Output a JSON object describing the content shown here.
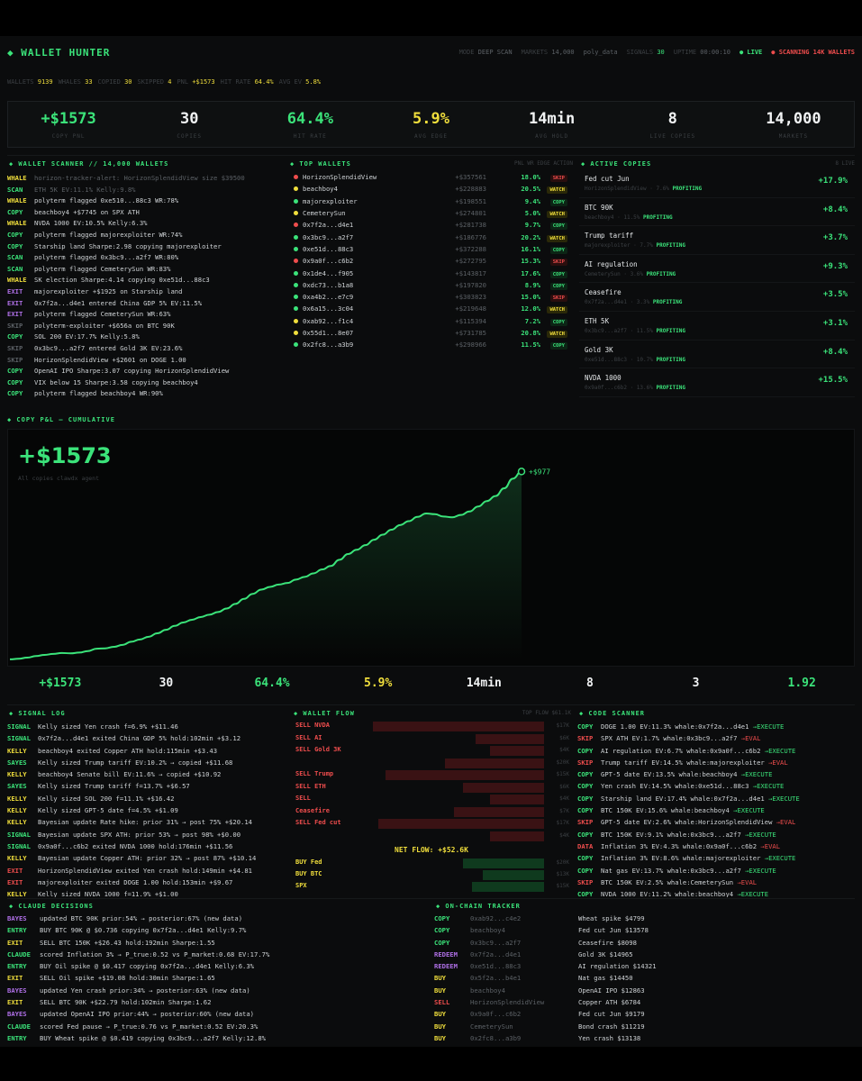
{
  "header": {
    "brand": "◆ WALLET HUNTER",
    "mode_label": "MODE",
    "mode_value": "DEEP SCAN",
    "markets_label": "MARKETS",
    "markets_value": "14,000",
    "feed": "poly_data",
    "signals_label": "SIGNALS",
    "signals_value": "30",
    "uptime_label": "UPTIME",
    "uptime_value": "00:00:10",
    "live": "● LIVE",
    "scanning": "● SCANNING 14K WALLETS"
  },
  "subbar": [
    {
      "label": "WALLETS",
      "value": "9139"
    },
    {
      "label": "WHALES",
      "value": "33"
    },
    {
      "label": "COPIED",
      "value": "30"
    },
    {
      "label": "SKIPPED",
      "value": "4"
    },
    {
      "label": "PNL",
      "value": "+$1573"
    },
    {
      "label": "HIT RATE",
      "value": "64.4%"
    },
    {
      "label": "AVG EV",
      "value": "5.8%"
    }
  ],
  "stats": [
    {
      "value": "+$1573",
      "label": "COPY PNL",
      "color": "#3be37a"
    },
    {
      "value": "30",
      "label": "COPIES",
      "color": "#f1f3f4"
    },
    {
      "value": "64.4%",
      "label": "HIT RATE",
      "color": "#3be37a"
    },
    {
      "value": "5.9%",
      "label": "AVG EDGE",
      "color": "#f0de3c"
    },
    {
      "value": "14min",
      "label": "AVG HOLD",
      "color": "#f1f3f4"
    },
    {
      "value": "8",
      "label": "LIVE COPIES",
      "color": "#f1f3f4"
    },
    {
      "value": "14,000",
      "label": "MARKETS",
      "color": "#f1f3f4"
    }
  ],
  "scanner": {
    "title": "◆ WALLET SCANNER // 14,000 WALLETS",
    "lines": [
      {
        "tag": "WHALE",
        "tc": "#f0de3c",
        "text": "horizon-tracker-alert: HorizonSplendidView size $39500",
        "c": "#5c6166"
      },
      {
        "tag": "SCAN",
        "tc": "#3be37a",
        "text": "ETH 5K EV:11.1% Kelly:9.8%",
        "c": "#5c6166"
      },
      {
        "tag": "WHALE",
        "tc": "#f0de3c",
        "text": "polyterm flagged 0xe510...88c3 WR:78%",
        "c": "#cfd3d6"
      },
      {
        "tag": "COPY",
        "tc": "#3be37a",
        "text": "beachboy4 +$7745 on SPX ATH",
        "c": "#cfd3d6"
      },
      {
        "tag": "WHALE",
        "tc": "#f0de3c",
        "text": "NVDA 1000 EV:10.5% Kelly:6.3%",
        "c": "#cfd3d6"
      },
      {
        "tag": "COPY",
        "tc": "#3be37a",
        "text": "polyterm flagged majorexploiter WR:74%",
        "c": "#cfd3d6"
      },
      {
        "tag": "COPY",
        "tc": "#3be37a",
        "text": "Starship land Sharpe:2.98 copying majorexploiter",
        "c": "#cfd3d6"
      },
      {
        "tag": "SCAN",
        "tc": "#3be37a",
        "text": "polyterm flagged 0x3bc9...a2f7 WR:80%",
        "c": "#cfd3d6"
      },
      {
        "tag": "SCAN",
        "tc": "#3be37a",
        "text": "polyterm flagged CemeterySun WR:83%",
        "c": "#cfd3d6"
      },
      {
        "tag": "WHALE",
        "tc": "#f0de3c",
        "text": "SK election Sharpe:4.14 copying 0xe51d...88c3",
        "c": "#cfd3d6"
      },
      {
        "tag": "EXIT",
        "tc": "#b070e8",
        "text": "majorexploiter +$1925 on Starship land",
        "c": "#cfd3d6"
      },
      {
        "tag": "EXIT",
        "tc": "#b070e8",
        "text": "0x7f2a...d4e1 entered China GDP 5% EV:11.5%",
        "c": "#cfd3d6"
      },
      {
        "tag": "EXIT",
        "tc": "#b070e8",
        "text": "polyterm flagged CemeterySun WR:63%",
        "c": "#cfd3d6"
      },
      {
        "tag": "SKIP",
        "tc": "#5c6166",
        "text": "polyterm-exploiter +$656a on BTC 90K",
        "c": "#cfd3d6"
      },
      {
        "tag": "COPY",
        "tc": "#3be37a",
        "text": "SOL 200 EV:17.7% Kelly:5.8%",
        "c": "#cfd3d6"
      },
      {
        "tag": "SKIP",
        "tc": "#5c6166",
        "text": "0x3bc9...a2f7 entered Gold 3K EV:23.6%",
        "c": "#cfd3d6"
      },
      {
        "tag": "SKIP",
        "tc": "#5c6166",
        "text": "HorizonSplendidView +$2601 on DOGE 1.00",
        "c": "#cfd3d6"
      },
      {
        "tag": "COPY",
        "tc": "#3be37a",
        "text": "OpenAI IPO Sharpe:3.07 copying HorizonSplendidView",
        "c": "#cfd3d6"
      },
      {
        "tag": "COPY",
        "tc": "#3be37a",
        "text": "VIX below 15 Sharpe:3.58 copying beachboy4",
        "c": "#cfd3d6"
      },
      {
        "tag": "COPY",
        "tc": "#3be37a",
        "text": "polyterm flagged beachboy4 WR:90%",
        "c": "#cfd3d6"
      }
    ]
  },
  "top_wallets": {
    "title": "◆ TOP WALLETS",
    "header_right": "PNL  WR  EDGE  ACTION",
    "rows": [
      {
        "dot": "#ef4d4d",
        "name": "HorizonSplendidView",
        "pnl": "+$357561",
        "wr": "18.0%",
        "act": "SKIP",
        "b": "skip"
      },
      {
        "dot": "#f0de3c",
        "name": "beachboy4",
        "pnl": "+$228883",
        "wr": "20.5%",
        "act": "WATCH",
        "b": "watch"
      },
      {
        "dot": "#3be37a",
        "name": "majorexploiter",
        "pnl": "+$198551",
        "wr": "9.4%",
        "act": "COPY",
        "b": "copy"
      },
      {
        "dot": "#f0de3c",
        "name": "CemeterySun",
        "pnl": "+$274801",
        "wr": "5.0%",
        "act": "WATCH",
        "b": "watch"
      },
      {
        "dot": "#ef4d4d",
        "name": "0x7f2a...d4e1",
        "pnl": "+$281738",
        "wr": "9.7%",
        "act": "COPY",
        "b": "copy"
      },
      {
        "dot": "#3be37a",
        "name": "0x3bc9...a2f7",
        "pnl": "+$186776",
        "wr": "20.2%",
        "act": "WATCH",
        "b": "watch"
      },
      {
        "dot": "#3be37a",
        "name": "0xe51d...88c3",
        "pnl": "+$372288",
        "wr": "16.1%",
        "act": "COPY",
        "b": "copy"
      },
      {
        "dot": "#ef4d4d",
        "name": "0x9a0f...c6b2",
        "pnl": "+$272795",
        "wr": "15.3%",
        "act": "SKIP",
        "b": "skip"
      },
      {
        "dot": "#3be37a",
        "name": "0x1de4...f905",
        "pnl": "+$143817",
        "wr": "17.6%",
        "act": "COPY",
        "b": "copy"
      },
      {
        "dot": "#3be37a",
        "name": "0xdc73...b1a8",
        "pnl": "+$197820",
        "wr": "8.9%",
        "act": "COPY",
        "b": "copy"
      },
      {
        "dot": "#3be37a",
        "name": "0xa4b2...e7c9",
        "pnl": "+$303823",
        "wr": "15.0%",
        "act": "SKIP",
        "b": "skip"
      },
      {
        "dot": "#3be37a",
        "name": "0x6a15...3c04",
        "pnl": "+$219648",
        "wr": "12.0%",
        "act": "WATCH",
        "b": "watch"
      },
      {
        "dot": "#f0de3c",
        "name": "0xab92...f1c4",
        "pnl": "+$115394",
        "wr": "7.2%",
        "act": "COPY",
        "b": "copy"
      },
      {
        "dot": "#f0de3c",
        "name": "0x55d1...8e07",
        "pnl": "+$731785",
        "wr": "20.8%",
        "act": "WATCH",
        "b": "watch"
      },
      {
        "dot": "#3be37a",
        "name": "0x2fc8...a3b9",
        "pnl": "+$298966",
        "wr": "11.5%",
        "act": "COPY",
        "b": "copy"
      }
    ]
  },
  "active_copies": {
    "title": "◆ ACTIVE COPIES",
    "count": "8 LIVE",
    "items": [
      {
        "name": "Fed cut Jun",
        "sub": "HorizonSplendidView · 7.6%",
        "status": "PROFITING",
        "pnl": "+17.9%"
      },
      {
        "name": "BTC 90K",
        "sub": "beachboy4 · 11.5%",
        "status": "PROFITING",
        "pnl": "+8.4%"
      },
      {
        "name": "Trump tariff",
        "sub": "majorexploiter · 7.7%",
        "status": "PROFITING",
        "pnl": "+3.7%"
      },
      {
        "name": "AI regulation",
        "sub": "CemeterySun · 3.6%",
        "status": "PROFITING",
        "pnl": "+9.3%"
      },
      {
        "name": "Ceasefire",
        "sub": "0x7f2a...d4e1 · 3.3%",
        "status": "PROFITING",
        "pnl": "+3.5%"
      },
      {
        "name": "ETH 5K",
        "sub": "0x3bc9...a2f7 · 11.5%",
        "status": "PROFITING",
        "pnl": "+3.1%"
      },
      {
        "name": "Gold 3K",
        "sub": "0xe51d...88c3 · 10.7%",
        "status": "PROFITING",
        "pnl": "+8.4%"
      },
      {
        "name": "NVDA 1000",
        "sub": "0x9a0f...c6b2 · 13.6%",
        "status": "PROFITING",
        "pnl": "+15.5%"
      }
    ]
  },
  "pnl_chart": {
    "title": "◆ COPY P&L — CUMULATIVE",
    "big_value": "+$1573",
    "big_sub": "All copies   clawdx agent",
    "end_label": "+$977"
  },
  "chart_data": {
    "type": "area",
    "title": "COPY P&L — CUMULATIVE",
    "x": [
      0,
      1,
      2,
      3,
      4,
      5,
      6,
      7,
      8,
      9,
      10,
      11,
      12,
      13,
      14,
      15,
      16,
      17,
      18,
      19,
      20,
      21,
      22,
      23,
      24,
      25,
      26,
      27,
      28,
      29,
      30,
      31,
      32,
      33,
      34,
      35,
      36,
      37,
      38,
      39,
      40,
      41,
      42,
      43,
      44,
      45,
      46,
      47,
      48,
      49,
      50,
      51,
      52,
      53,
      54,
      55,
      56,
      57,
      58,
      59
    ],
    "series": [
      {
        "values": [
          5,
          8,
          14,
          22,
          28,
          33,
          38,
          36,
          40,
          48,
          60,
          62,
          70,
          80,
          96,
          108,
          122,
          140,
          158,
          178,
          196,
          210,
          224,
          236,
          250,
          268,
          292,
          318,
          344,
          366,
          380,
          392,
          400,
          418,
          432,
          450,
          470,
          488,
          520,
          550,
          572,
          596,
          624,
          650,
          676,
          700,
          720,
          742,
          760,
          756,
          744,
          740,
          752,
          770,
          796,
          824,
          850,
          890,
          940,
          977
        ]
      }
    ],
    "ylim": [
      0,
      1100
    ],
    "grid": false,
    "line_color": "#3be37a"
  },
  "stats2": [
    {
      "value": "+$1573",
      "color": "#3be37a"
    },
    {
      "value": "30",
      "color": "#f1f3f4"
    },
    {
      "value": "64.4%",
      "color": "#3be37a"
    },
    {
      "value": "5.9%",
      "color": "#f0de3c"
    },
    {
      "value": "14min",
      "color": "#f1f3f4"
    },
    {
      "value": "8",
      "color": "#f1f3f4"
    },
    {
      "value": "3",
      "color": "#f1f3f4"
    },
    {
      "value": "1.92",
      "color": "#3be37a"
    }
  ],
  "signal_log": {
    "title": "◆ SIGNAL LOG",
    "lines": [
      {
        "tag": "SIGNAL",
        "tc": "#3be37a",
        "text": "Kelly sized Yen crash f=6.9% +$11.46"
      },
      {
        "tag": "SIGNAL",
        "tc": "#3be37a",
        "text": "0x7f2a...d4e1 exited China GDP 5% hold:102min +$3.12"
      },
      {
        "tag": "KELLY",
        "tc": "#f0de3c",
        "text": "beachboy4 exited Copper ATH hold:115min +$3.43"
      },
      {
        "tag": "SAYES",
        "tc": "#3be37a",
        "text": "Kelly sized Trump tariff EV:10.2% → copied +$11.68"
      },
      {
        "tag": "KELLY",
        "tc": "#f0de3c",
        "text": "beachboy4 Senate bill EV:11.6% → copied +$10.92"
      },
      {
        "tag": "SAYES",
        "tc": "#3be37a",
        "text": "Kelly sized Trump tariff f=13.7% +$6.57"
      },
      {
        "tag": "KELLY",
        "tc": "#f0de3c",
        "text": "Kelly sized SOL 200 f=11.1% +$16.42"
      },
      {
        "tag": "KELLY",
        "tc": "#f0de3c",
        "text": "Kelly sized GPT-5 date f=4.5% +$1.09"
      },
      {
        "tag": "KELLY",
        "tc": "#f0de3c",
        "text": "Bayesian update Rate hike: prior 31% → post 75% +$20.14"
      },
      {
        "tag": "SIGNAL",
        "tc": "#3be37a",
        "text": "Bayesian update SPX ATH: prior 53% → post 98% +$0.00"
      },
      {
        "tag": "SIGNAL",
        "tc": "#3be37a",
        "text": "0x9a0f...c6b2 exited NVDA 1000 hold:176min +$11.56"
      },
      {
        "tag": "KELLY",
        "tc": "#f0de3c",
        "text": "Bayesian update Copper ATH: prior 32% → post 87% +$10.14"
      },
      {
        "tag": "EXIT",
        "tc": "#ef4d4d",
        "text": "HorizonSplendidView exited Yen crash hold:149min +$4.81"
      },
      {
        "tag": "EXIT",
        "tc": "#ef4d4d",
        "text": "majorexploiter exited DOGE 1.00 hold:153min +$9.67"
      },
      {
        "tag": "KELLY",
        "tc": "#f0de3c",
        "text": "Kelly sized NVDA 1000 f=11.9% +$1.00"
      }
    ]
  },
  "wallet_flow": {
    "title": "◆ WALLET FLOW",
    "total": "TOP FLOW $61.1K",
    "sells": [
      {
        "label": "SELL NVDA",
        "v": "$17K",
        "w": 0.95
      },
      {
        "label": "SELL AI",
        "v": "$6K",
        "w": 0.38
      },
      {
        "label": "SELL Gold 3K",
        "v": "$4K",
        "w": 0.3
      },
      {
        "label": "",
        "v": "$20K",
        "w": 0.55
      },
      {
        "label": "SELL Trump",
        "v": "$15K",
        "w": 0.88
      },
      {
        "label": "SELL ETH",
        "v": "$6K",
        "w": 0.45
      },
      {
        "label": "SELL",
        "v": "$4K",
        "w": 0.3
      },
      {
        "label": "Ceasefire",
        "v": "$7K",
        "w": 0.5
      },
      {
        "label": "SELL Fed cut",
        "v": "$17K",
        "w": 0.92
      },
      {
        "label": "",
        "v": "$4K",
        "w": 0.3
      }
    ],
    "net": "NET FLOW: +$52.6K",
    "buys": [
      {
        "label": "BUY Fed",
        "v": "$20K",
        "w": 0.45
      },
      {
        "label": "BUY BTC",
        "v": "$13K",
        "w": 0.34
      },
      {
        "label": "SPX",
        "v": "$15K",
        "w": 0.4
      }
    ]
  },
  "code_scanner": {
    "title": "◆ CODE SCANNER",
    "lines": [
      {
        "tag": "COPY",
        "tc": "#3be37a",
        "text": "DOGE 1.00 EV:11.3% whale:0x7f2a...d4e1 ",
        "act": "→EXECUTE",
        "ac": "#3be37a"
      },
      {
        "tag": "SKIP",
        "tc": "#ef4d4d",
        "text": "SPX ATH EV:1.7% whale:0x3bc9...a2f7 ",
        "act": "→EVAL",
        "ac": "#ef4d4d"
      },
      {
        "tag": "COPY",
        "tc": "#3be37a",
        "text": "AI regulation EV:6.7% whale:0x9a0f...c6b2 ",
        "act": "→EXECUTE",
        "ac": "#3be37a"
      },
      {
        "tag": "SKIP",
        "tc": "#ef4d4d",
        "text": "Trump tariff EV:14.5% whale:majorexploiter ",
        "act": "→EVAL",
        "ac": "#ef4d4d"
      },
      {
        "tag": "COPY",
        "tc": "#3be37a",
        "text": "GPT-5 date EV:13.5% whale:beachboy4 ",
        "act": "→EXECUTE",
        "ac": "#3be37a"
      },
      {
        "tag": "COPY",
        "tc": "#3be37a",
        "text": "Yen crash EV:14.5% whale:0xe51d...88c3 ",
        "act": "→EXECUTE",
        "ac": "#3be37a"
      },
      {
        "tag": "COPY",
        "tc": "#3be37a",
        "text": "Starship land EV:17.4% whale:0x7f2a...d4e1 ",
        "act": "→EXECUTE",
        "ac": "#3be37a"
      },
      {
        "tag": "COPY",
        "tc": "#3be37a",
        "text": "BTC 150K EV:15.6% whale:beachboy4 ",
        "act": "→EXECUTE",
        "ac": "#3be37a"
      },
      {
        "tag": "SKIP",
        "tc": "#ef4d4d",
        "text": "GPT-5 date EV:2.6% whale:HorizonSplendidView ",
        "act": "→EVAL",
        "ac": "#ef4d4d"
      },
      {
        "tag": "COPY",
        "tc": "#3be37a",
        "text": "BTC 150K EV:9.1% whale:0x3bc9...a2f7 ",
        "act": "→EXECUTE",
        "ac": "#3be37a"
      },
      {
        "tag": "DATA",
        "tc": "#ef4d4d",
        "text": "Inflation 3% EV:4.3% whale:0x9a0f...c6b2 ",
        "act": "→EVAL",
        "ac": "#ef4d4d"
      },
      {
        "tag": "COPY",
        "tc": "#3be37a",
        "text": "Inflation 3% EV:8.6% whale:majorexploiter ",
        "act": "→EXECUTE",
        "ac": "#3be37a"
      },
      {
        "tag": "COPY",
        "tc": "#3be37a",
        "text": "Nat gas EV:13.7% whale:0x3bc9...a2f7 ",
        "act": "→EXECUTE",
        "ac": "#3be37a"
      },
      {
        "tag": "SKIP",
        "tc": "#ef4d4d",
        "text": "BTC 150K EV:2.5% whale:CemeterySun ",
        "act": "→EVAL",
        "ac": "#ef4d4d"
      },
      {
        "tag": "COPY",
        "tc": "#3be37a",
        "text": "NVDA 1000 EV:11.2% whale:beachboy4 ",
        "act": "→EXECUTE",
        "ac": "#3be37a"
      }
    ]
  },
  "claude": {
    "title": "◆ CLAUDE DECISIONS",
    "lines": [
      {
        "tag": "BAYES",
        "tc": "#b070e8",
        "text": "updated BTC 90K prior:54% → posterior:67% (new data)"
      },
      {
        "tag": "ENTRY",
        "tc": "#3be37a",
        "text": "BUY BTC 90K @ $0.736 copying 0x7f2a...d4e1 Kelly:9.7%"
      },
      {
        "tag": "EXIT",
        "tc": "#f0de3c",
        "text": "SELL BTC 150K +$26.43 hold:192min Sharpe:1.55"
      },
      {
        "tag": "CLAUDE",
        "tc": "#3be37a",
        "text": "scored Inflation 3% → P_true:0.52 vs P_market:0.68 EV:17.7%"
      },
      {
        "tag": "ENTRY",
        "tc": "#3be37a",
        "text": "BUY Oil spike @ $0.417 copying 0x7f2a...d4e1 Kelly:6.3%"
      },
      {
        "tag": "EXIT",
        "tc": "#f0de3c",
        "text": "SELL Oil spike +$19.08 hold:30min Sharpe:1.65"
      },
      {
        "tag": "BAYES",
        "tc": "#b070e8",
        "text": "updated Yen crash prior:34% → posterior:63% (new data)"
      },
      {
        "tag": "EXIT",
        "tc": "#f0de3c",
        "text": "SELL BTC 90K +$22.79 hold:102min Sharpe:1.62"
      },
      {
        "tag": "BAYES",
        "tc": "#b070e8",
        "text": "updated OpenAI IPO prior:44% → posterior:60% (new data)"
      },
      {
        "tag": "CLAUDE",
        "tc": "#3be37a",
        "text": "scored Fed pause → P_true:0.76 vs P_market:0.52 EV:20.3%"
      },
      {
        "tag": "ENTRY",
        "tc": "#3be37a",
        "text": "BUY Wheat spike @ $0.419 copying 0x3bc9...a2f7 Kelly:12.8%"
      }
    ]
  },
  "onchain": {
    "title": "◆ ON-CHAIN TRACKER",
    "lines": [
      {
        "tag": "COPY",
        "tc": "#3be37a",
        "who": "0xab92...c4e2",
        "text": "Wheat spike $4799"
      },
      {
        "tag": "COPY",
        "tc": "#3be37a",
        "who": "beachboy4",
        "text": "Fed cut Jun $13578"
      },
      {
        "tag": "COPY",
        "tc": "#3be37a",
        "who": "0x3bc9...a2f7",
        "text": "Ceasefire $8098"
      },
      {
        "tag": "REDEEM",
        "tc": "#b070e8",
        "who": "0x7f2a...d4e1",
        "text": "Gold 3K $14965"
      },
      {
        "tag": "REDEEM",
        "tc": "#b070e8",
        "who": "0xe51d...88c3",
        "text": "AI regulation $14321"
      },
      {
        "tag": "BUY",
        "tc": "#f0de3c",
        "who": "0x5f2a...b4e1",
        "text": "Nat gas $14450"
      },
      {
        "tag": "BUY",
        "tc": "#f0de3c",
        "who": "beachboy4",
        "text": "OpenAI IPO $12863"
      },
      {
        "tag": "SELL",
        "tc": "#ef4d4d",
        "who": "HorizonSplendidView",
        "text": "Copper ATH $6784"
      },
      {
        "tag": "BUY",
        "tc": "#f0de3c",
        "who": "0x9a0f...c6b2",
        "text": "Fed cut Jun $9179"
      },
      {
        "tag": "BUY",
        "tc": "#f0de3c",
        "who": "CemeterySun",
        "text": "Bond crash $11219"
      },
      {
        "tag": "BUY",
        "tc": "#f0de3c",
        "who": "0x2fc8...a3b9",
        "text": "Yen crash $13138"
      }
    ]
  }
}
